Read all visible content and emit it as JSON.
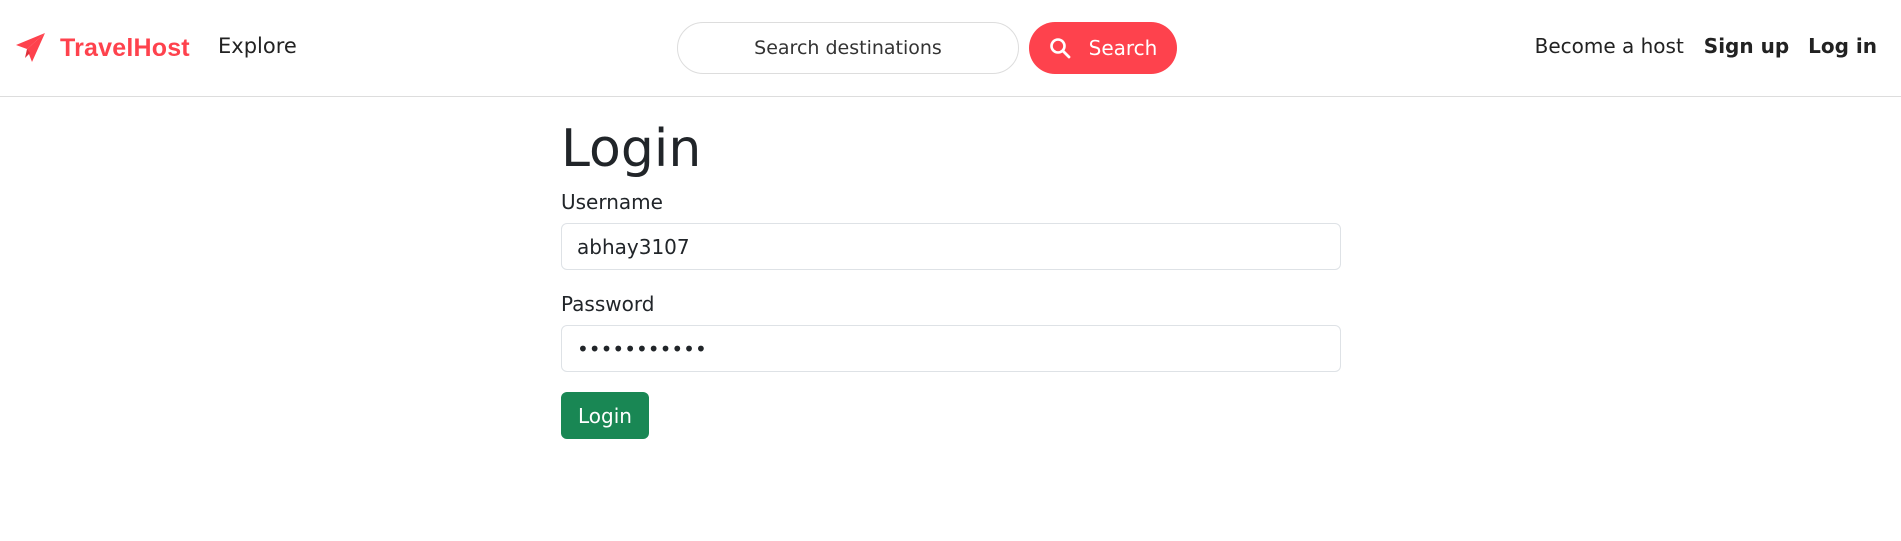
{
  "navbar": {
    "brand_name": "TravelHost",
    "brand_icon": "paper-plane-icon",
    "explore_label": "Explore",
    "search": {
      "placeholder": "Search destinations",
      "value": "",
      "button_label": "Search",
      "button_icon": "search-icon"
    },
    "become_host_label": "Become a host",
    "signup_label": "Sign up",
    "login_label": "Log in"
  },
  "login_form": {
    "title": "Login",
    "username_label": "Username",
    "username_value": "abhay3107",
    "password_label": "Password",
    "password_value": "abhay310704",
    "submit_label": "Login"
  },
  "colors": {
    "brand": "#fe424d",
    "submit_button": "#198754",
    "border": "#dddddd"
  }
}
